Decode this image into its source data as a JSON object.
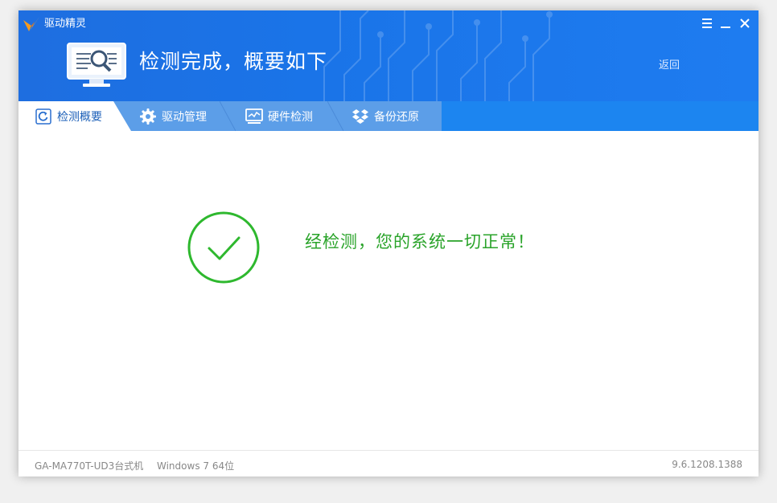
{
  "app": {
    "title": "驱动精灵"
  },
  "header": {
    "title": "检测完成，概要如下",
    "back_label": "返回"
  },
  "tabs": [
    {
      "label": "检测概要",
      "icon": "refresh-icon",
      "active": true
    },
    {
      "label": "驱动管理",
      "icon": "gear-icon",
      "active": false
    },
    {
      "label": "硬件检测",
      "icon": "monitor-icon",
      "active": false
    },
    {
      "label": "备份还原",
      "icon": "dropbox-icon",
      "active": false
    }
  ],
  "main": {
    "result_message": "经检测，您的系统一切正常！",
    "status_icon": "check-circle-icon"
  },
  "footer": {
    "machine": "GA-MA770T-UD3台式机",
    "os": "Windows 7 64位",
    "version": "9.6.1208.1388"
  },
  "colors": {
    "header_blue": "#1a74e8",
    "tab_bar": "#1c85f0",
    "success_green": "#29a329",
    "logo_orange": "#f39a1e"
  }
}
